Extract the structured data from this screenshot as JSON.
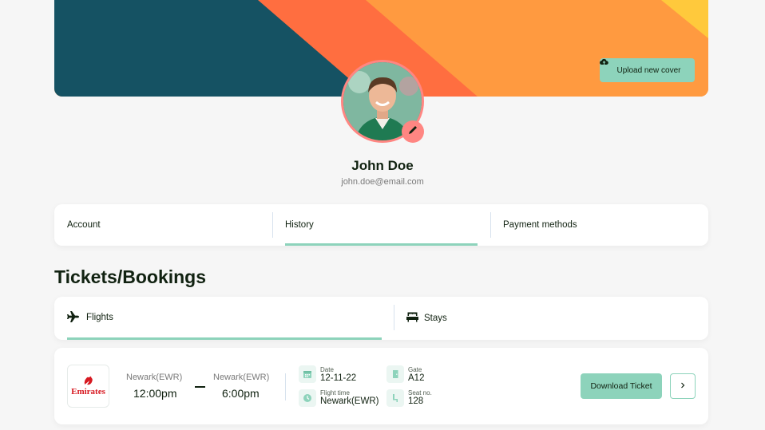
{
  "cover": {
    "upload_label": "Upload new cover",
    "colors": {
      "teal": "#155263",
      "orange": "#ff6e40",
      "light_orange": "#ff9a40",
      "yellow": "#ffc93c"
    }
  },
  "profile": {
    "name": "John Doe",
    "email": "john.doe@email.com",
    "avatar_border": "#ff8682"
  },
  "tabs": [
    {
      "label": "Account",
      "active": false
    },
    {
      "label": "History",
      "active": true
    },
    {
      "label": "Payment methods",
      "active": false
    }
  ],
  "section_title": "Tickets/Bookings",
  "subtabs": [
    {
      "label": "Flights",
      "icon": "airplane-icon",
      "active": true
    },
    {
      "label": "Stays",
      "icon": "bed-icon",
      "active": false
    }
  ],
  "booking": {
    "airline_logo_text": "Emirates",
    "from_label": "Newark(EWR)",
    "from_time": "12:00pm",
    "to_label": "Newark(EWR)",
    "to_time": "6:00pm",
    "date_label": "Date",
    "date_value": "12-11-22",
    "gate_label": "Gate",
    "gate_value": "A12",
    "flight_time_label": "Flight time",
    "flight_time_value": "Newark(EWR)",
    "seat_label": "Seat no.",
    "seat_value": "128",
    "download_label": "Download Ticket"
  },
  "accent": "#8dd3bb"
}
